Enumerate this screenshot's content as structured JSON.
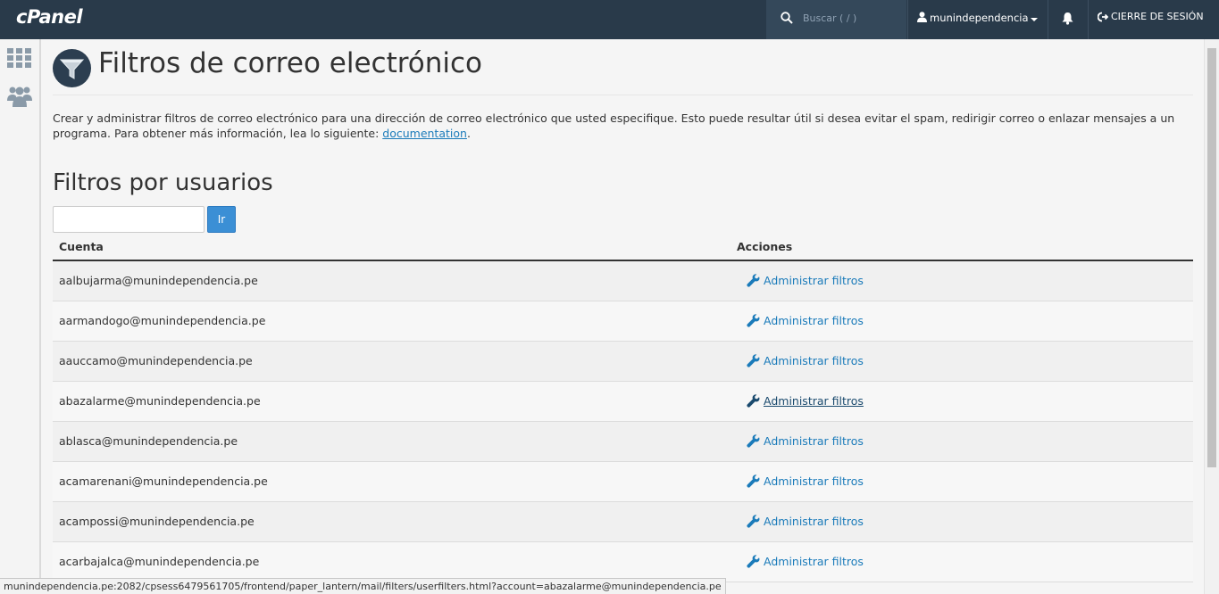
{
  "topbar": {
    "logo": "cPanel",
    "search_placeholder": "Buscar ( / )",
    "username": "munindependencia",
    "logout_label": "CIERRE DE SESIÓN"
  },
  "page": {
    "title": "Filtros de correo electrónico",
    "intro_text": "Crear y administrar filtros de correo electrónico para una dirección de correo electrónico que usted especifique. Esto puede resultar útil si desea evitar el spam, redirigir correo o enlazar mensajes a un programa. Para obtener más información, lea lo siguiente: ",
    "intro_link": "documentation",
    "intro_end": ".",
    "section_title": "Filtros por usuarios",
    "go_button": "Ir",
    "filter_input_value": ""
  },
  "table": {
    "headers": {
      "account": "Cuenta",
      "actions": "Acciones"
    },
    "rows": [
      {
        "account": "aalbujarma@munindependencia.pe",
        "action": "Administrar filtros"
      },
      {
        "account": "aarmandogo@munindependencia.pe",
        "action": "Administrar filtros"
      },
      {
        "account": "aauccamo@munindependencia.pe",
        "action": "Administrar filtros"
      },
      {
        "account": "abazalarme@munindependencia.pe",
        "action": "Administrar filtros"
      },
      {
        "account": "ablasca@munindependencia.pe",
        "action": "Administrar filtros"
      },
      {
        "account": "acamarenani@munindependencia.pe",
        "action": "Administrar filtros"
      },
      {
        "account": "acampossi@munindependencia.pe",
        "action": "Administrar filtros"
      },
      {
        "account": "acarbajalca@munindependencia.pe",
        "action": "Administrar filtros"
      }
    ]
  },
  "statusbar": {
    "url": "munindependencia.pe:2082/cpsess6479561705/frontend/paper_lantern/mail/filters/userfilters.html?account=abazalarme@munindependencia.pe"
  },
  "colors": {
    "topbar": "#293a4a",
    "link": "#1b7bba",
    "button": "#3b8fd5"
  },
  "icons": {
    "search": "search-icon",
    "user": "user-icon",
    "bell": "bell-icon",
    "logout": "logout-icon",
    "apps": "grid-icon",
    "users": "users-icon",
    "filter": "funnel-icon",
    "wrench": "wrench-icon"
  }
}
